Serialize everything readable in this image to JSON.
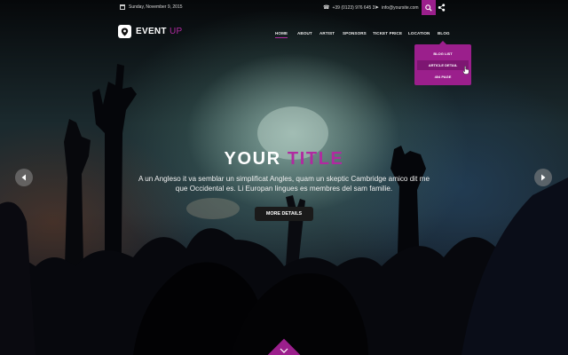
{
  "topbar": {
    "date": "Sunday, November 9, 2015",
    "phone": "+39 (0123) 976 645 3",
    "email": "info@yoursite.com"
  },
  "logo": {
    "word1": "EVENT",
    "word2": "UP"
  },
  "nav": {
    "items": [
      {
        "label": "HOME",
        "active": true
      },
      {
        "label": "ABOUT"
      },
      {
        "label": "ARTIST"
      },
      {
        "label": "SPONSORS"
      },
      {
        "label": "TICKET PRICE"
      },
      {
        "label": "LOCATION"
      },
      {
        "label": "BLOG"
      }
    ],
    "dropdown": [
      "BLOG LIST",
      "ARTICLE DETAIL",
      "404 PAGE"
    ]
  },
  "hero": {
    "title_part1": "YOUR",
    "title_part2": "TITLE",
    "description_line1": "A un Angleso it va semblar un simplificat Angles, quam un skeptic Cambridge amico dit me",
    "description_line2": "que Occidental es. Li Europan lingues es membres del sam familie.",
    "button": "MORE DETAILS"
  },
  "colors": {
    "accent": "#9b1f8c",
    "accent_text": "#b02aa0"
  },
  "icons": {
    "date": "calendar-icon",
    "phone": "phone-icon",
    "email": "paper-plane-icon",
    "search": "search-icon",
    "share": "share-icon",
    "prev": "chevron-left-icon",
    "next": "chevron-right-icon",
    "scroll": "chevron-down-icon"
  }
}
